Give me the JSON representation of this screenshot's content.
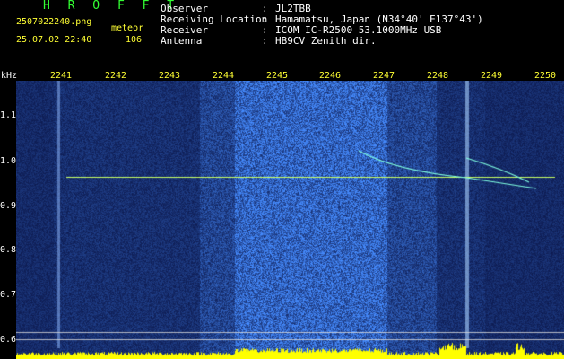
{
  "header": {
    "app_title": "H R O F F T",
    "file_name": "2507022240.png",
    "datetime": "25.07.02 22:40",
    "event_type": "meteor",
    "count": "106"
  },
  "station": {
    "labels": [
      "Observer",
      "Receiving Location",
      "Receiver",
      "Antenna"
    ],
    "colon": ":",
    "values": [
      "JL2TBB",
      "Hamamatsu, Japan (N34°40' E137°43')",
      "ICOM IC-R2500 53.1000MHz USB",
      "HB9CV Zenith dir."
    ]
  },
  "axes": {
    "y_unit": "kHz",
    "x_ticks": [
      "2241",
      "2242",
      "2243",
      "2244",
      "2245",
      "2246",
      "2247",
      "2248",
      "2249",
      "2250"
    ],
    "y_ticks": [
      "1.1",
      "1.0",
      "0.9",
      "0.8",
      "0.7",
      "0.6"
    ]
  },
  "colors": {
    "title": "#33ff33",
    "meta_text": "#ffff33",
    "info_text": "#ffffff",
    "background": "#000000",
    "noise_low": "#0a1a6e",
    "noise_high": "#2f6bff",
    "carrier": "#c8ff64",
    "meteor_trace": "#80ffe0",
    "level_bars": "#ffff00"
  }
}
